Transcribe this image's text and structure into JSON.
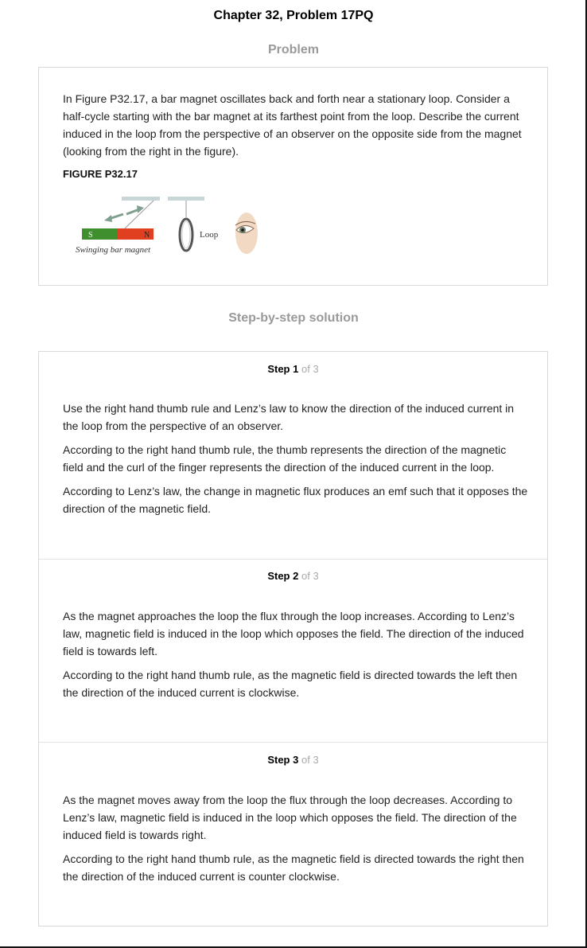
{
  "header": {
    "title": "Chapter 32, Problem 17PQ"
  },
  "problem": {
    "heading": "Problem",
    "text": "In Figure P32.17, a bar magnet oscillates back and forth near a stationary loop. Consider a half-cycle starting with the bar magnet at its farthest point from the loop. Describe the current induced in the loop from the perspective of an observer on the opposite side from the magnet (looking from the right in the figure).",
    "figure_label": "FIGURE P32.17",
    "figure": {
      "magnet_s": "S",
      "magnet_n": "N",
      "magnet_caption": "Swinging bar magnet",
      "loop_label": "Loop",
      "colors": {
        "south": "#3f8f2f",
        "north": "#e0401f",
        "arrow": "#7f9f8f"
      }
    }
  },
  "solution": {
    "heading": "Step-by-step solution",
    "steps": [
      {
        "label": "Step",
        "number": "1",
        "of": "of 3",
        "paragraphs": [
          "Use the right hand thumb rule and Lenz’s law to know the direction of the induced current in the loop from the perspective of an observer.",
          "According to the right hand thumb rule, the thumb represents the direction of the magnetic field and the curl of the finger represents the direction of the induced current in the loop.",
          "According to Lenz’s law, the change in magnetic flux produces an emf such that it opposes the direction of the magnetic field."
        ]
      },
      {
        "label": "Step",
        "number": "2",
        "of": "of 3",
        "paragraphs": [
          "As the magnet approaches the loop the flux through the loop increases. According to Lenz’s law, magnetic field is induced in the loop which opposes the field. The direction of the induced field is towards left.",
          "According to the right hand thumb rule, as the magnetic field is directed towards the left then the direction of the induced current is clockwise."
        ]
      },
      {
        "label": "Step",
        "number": "3",
        "of": "of 3",
        "paragraphs": [
          "As the magnet moves away from the loop the flux through the loop decreases. According to Lenz’s law, magnetic field is induced in the loop which opposes the field. The direction of the induced field is towards right.",
          "According to the right hand thumb rule, as the magnetic field is directed towards the right then the direction of the induced current is counter clockwise."
        ]
      }
    ]
  }
}
